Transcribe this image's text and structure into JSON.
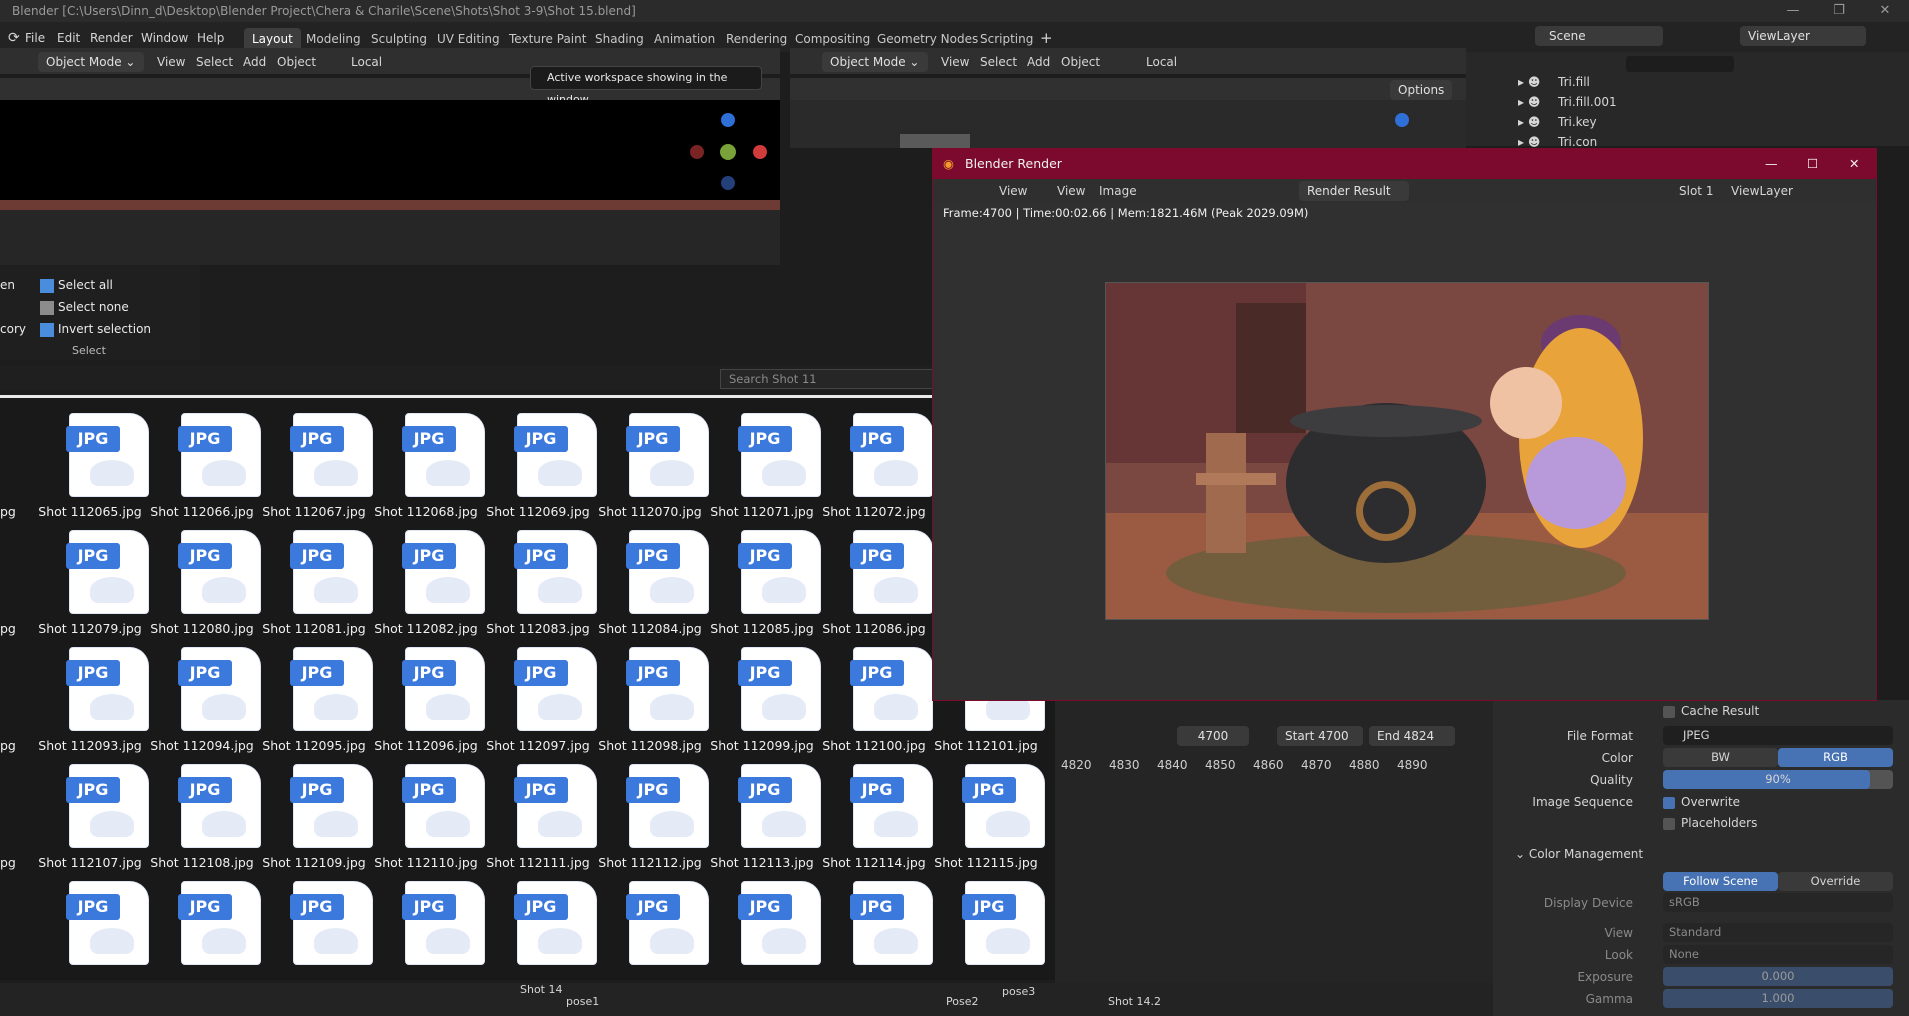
{
  "window": {
    "title": "Blender [C:\\Users\\Dinn_d\\Desktop\\Blender Project\\Chera & Charile\\Scene\\Shots\\Shot 3-9\\Shot 15.blend]"
  },
  "menu": [
    "File",
    "Edit",
    "Render",
    "Window",
    "Help"
  ],
  "workspaces": [
    "Layout",
    "Modeling",
    "Sculpting",
    "UV Editing",
    "Texture Paint",
    "Shading",
    "Animation",
    "Rendering",
    "Compositing",
    "Geometry Nodes",
    "Scripting"
  ],
  "active_workspace": "Layout",
  "scene": {
    "scene_name": "Scene",
    "view_layer": "ViewLayer"
  },
  "viewport_left": {
    "mode": "Object Mode",
    "view": "View",
    "select": "Select",
    "add": "Add",
    "object": "Object",
    "orientation": "Local",
    "tooltip": "Active workspace showing in the window."
  },
  "viewport_right": {
    "mode": "Object Mode",
    "view": "View",
    "select": "Select",
    "add": "Add",
    "object": "Object",
    "orientation": "Local",
    "options": "Options"
  },
  "outliner": {
    "search_placeholder": "",
    "items": [
      "Tri.fill",
      "Tri.fill.001",
      "Tri.key",
      "Tri.con"
    ]
  },
  "ribbon": {
    "items": [
      "Select all",
      "Select none",
      "Invert selection"
    ],
    "group_label": "Select",
    "left_items": [
      "en",
      "",
      "cory"
    ]
  },
  "explorer": {
    "search_placeholder": "Search Shot 11",
    "tag": "JPG",
    "rows": [
      [
        "Shot 112065.jpg",
        "Shot 112066.jpg",
        "Shot 112067.jpg",
        "Shot 112068.jpg",
        "Shot 112069.jpg",
        "Shot 112070.jpg",
        "Shot 112071.jpg",
        "Shot 112072.jpg",
        ""
      ],
      [
        "Shot 112079.jpg",
        "Shot 112080.jpg",
        "Shot 112081.jpg",
        "Shot 112082.jpg",
        "Shot 112083.jpg",
        "Shot 112084.jpg",
        "Shot 112085.jpg",
        "Shot 112086.jpg",
        ""
      ],
      [
        "Shot 112093.jpg",
        "Shot 112094.jpg",
        "Shot 112095.jpg",
        "Shot 112096.jpg",
        "Shot 112097.jpg",
        "Shot 112098.jpg",
        "Shot 112099.jpg",
        "Shot 112100.jpg",
        "Shot 112101.jpg"
      ],
      [
        "Shot 112107.jpg",
        "Shot 112108.jpg",
        "Shot 112109.jpg",
        "Shot 112110.jpg",
        "Shot 112111.jpg",
        "Shot 112112.jpg",
        "Shot 112113.jpg",
        "Shot 112114.jpg",
        "Shot 112115.jpg"
      ],
      [
        "",
        "",
        "",
        "",
        "",
        "",
        "",
        "",
        ""
      ]
    ],
    "left_partial": [
      "pg",
      "pg",
      "pg",
      "pg",
      ""
    ]
  },
  "render_window": {
    "title": "Blender Render",
    "menu": [
      "View",
      "View",
      "Image"
    ],
    "image_name": "Render Result",
    "slot": "Slot 1",
    "view_layer": "ViewLayer",
    "stats": "Frame:4700 | Time:00:02.66 | Mem:1821.46M (Peak 2029.09M)"
  },
  "timeline": {
    "current_frame": "4700",
    "start_label": "Start",
    "start": "4700",
    "end_label": "End",
    "end": "4824",
    "ticks": [
      "4820",
      "4830",
      "4840",
      "4850",
      "4860",
      "4870",
      "4880",
      "4890"
    ]
  },
  "properties": {
    "cache_result": "Cache Result",
    "file_format_label": "File Format",
    "file_format": "JPEG",
    "color_label": "Color",
    "color_bw": "BW",
    "color_rgb": "RGB",
    "quality_label": "Quality",
    "quality": "90%",
    "quality_value": 0.9,
    "image_sequence_label": "Image Sequence",
    "overwrite": "Overwrite",
    "placeholders": "Placeholders",
    "color_mgmt": "Color Management",
    "follow_scene": "Follow Scene",
    "override": "Override",
    "display_device_label": "Display Device",
    "display_device": "sRGB",
    "view_label": "View",
    "view": "Standard",
    "look_label": "Look",
    "look": "None",
    "exposure_label": "Exposure",
    "exposure": "0.000",
    "gamma_label": "Gamma",
    "gamma": "1.000"
  },
  "sequencer": {
    "markers": [
      "Shot 14",
      "pose1",
      "Pose2",
      "pose3",
      "Shot 14.2"
    ]
  },
  "colors": {
    "accent": "#4772b3",
    "render_title": "#7c0a2e",
    "jpg_blue": "#3b79dc"
  }
}
